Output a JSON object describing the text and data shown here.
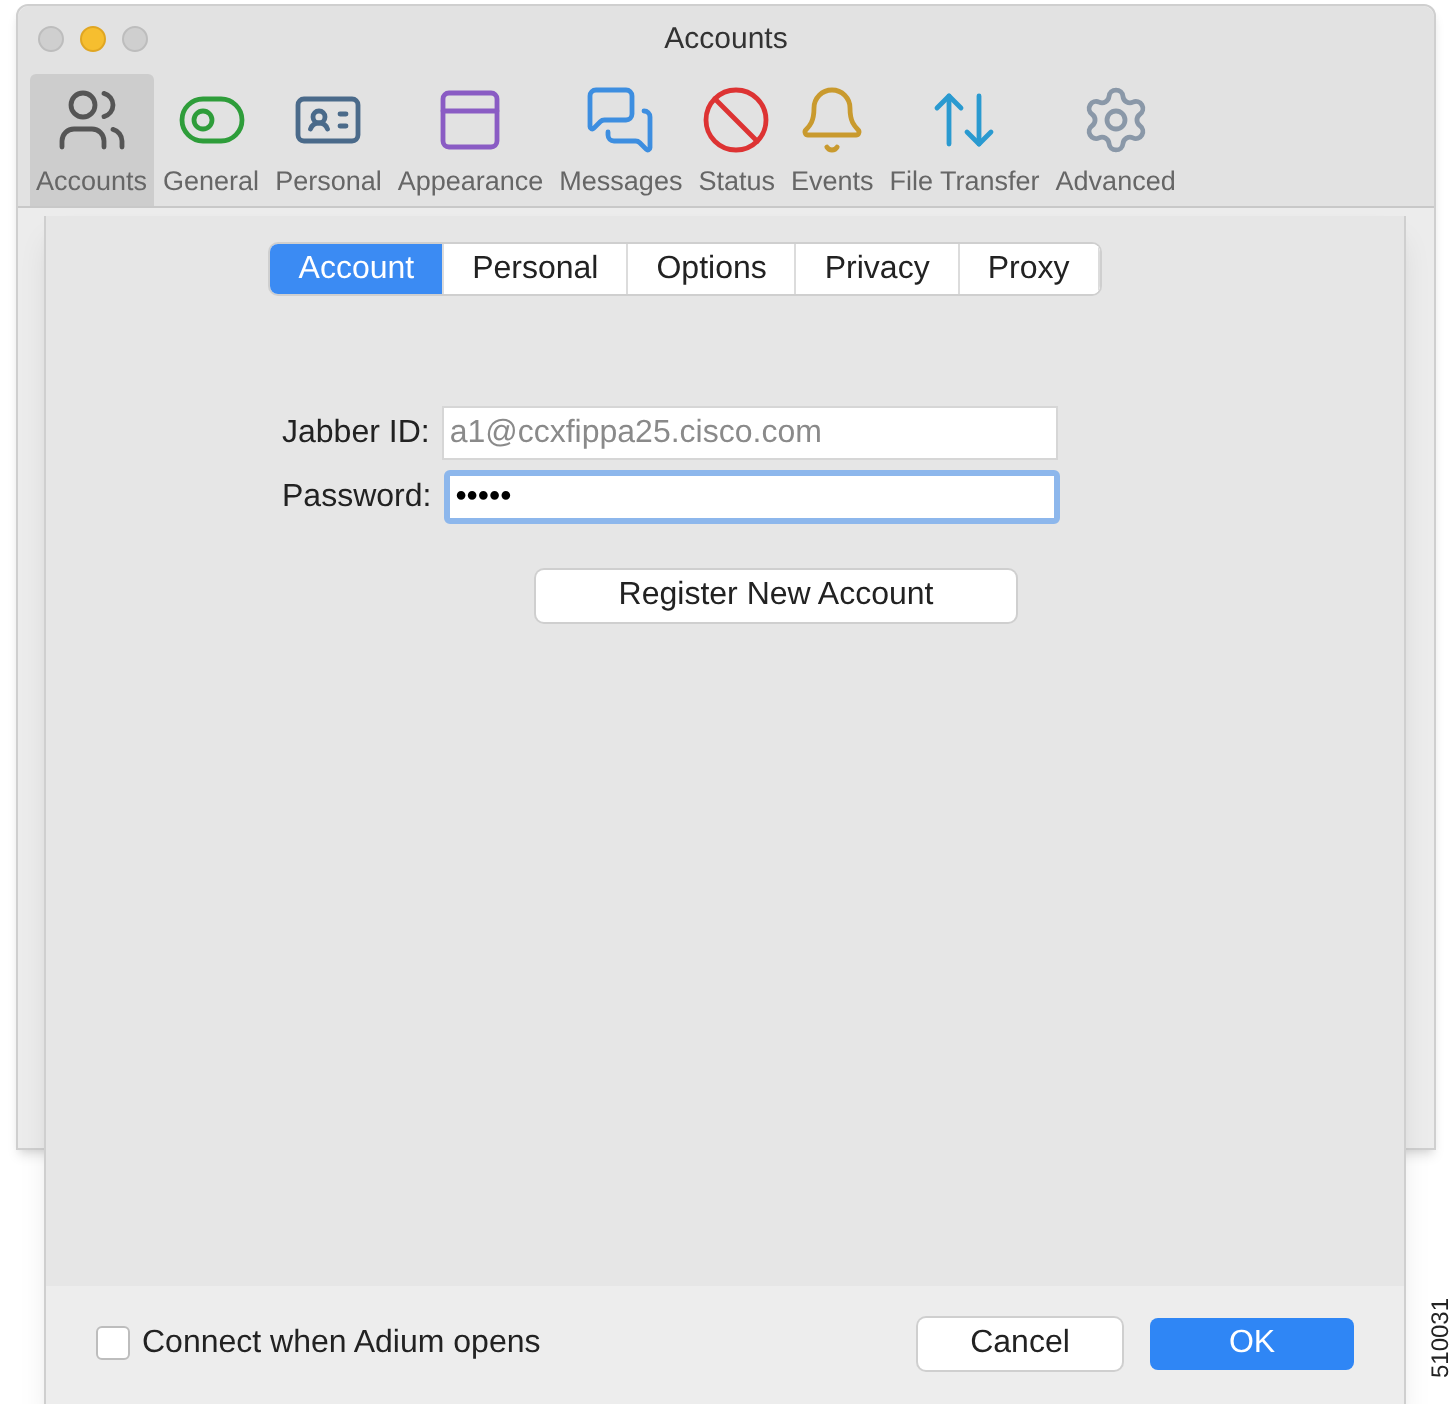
{
  "window": {
    "title": "Accounts"
  },
  "toolbar": [
    {
      "label": "Accounts",
      "selected": true
    },
    {
      "label": "General",
      "selected": false
    },
    {
      "label": "Personal",
      "selected": false
    },
    {
      "label": "Appearance",
      "selected": false
    },
    {
      "label": "Messages",
      "selected": false
    },
    {
      "label": "Status",
      "selected": false
    },
    {
      "label": "Events",
      "selected": false
    },
    {
      "label": "File Transfer",
      "selected": false
    },
    {
      "label": "Advanced",
      "selected": false
    }
  ],
  "sheet": {
    "tabs": [
      {
        "label": "Account",
        "selected": true
      },
      {
        "label": "Personal",
        "selected": false
      },
      {
        "label": "Options",
        "selected": false
      },
      {
        "label": "Privacy",
        "selected": false
      },
      {
        "label": "Proxy",
        "selected": false
      }
    ],
    "jabber_id": {
      "label": "Jabber ID:",
      "placeholder": "a1@ccxfippa25.cisco.com",
      "focused": false
    },
    "password": {
      "label": "Password:",
      "value": "•••••",
      "focused": true
    },
    "register_button": "Register New Account",
    "connect_checkbox": {
      "label": "Connect when Adium opens",
      "checked": false
    },
    "buttons": [
      {
        "label": "Cancel",
        "kind": "secondary"
      },
      {
        "label": "OK",
        "kind": "primary"
      }
    ]
  },
  "figure_number": "510031"
}
